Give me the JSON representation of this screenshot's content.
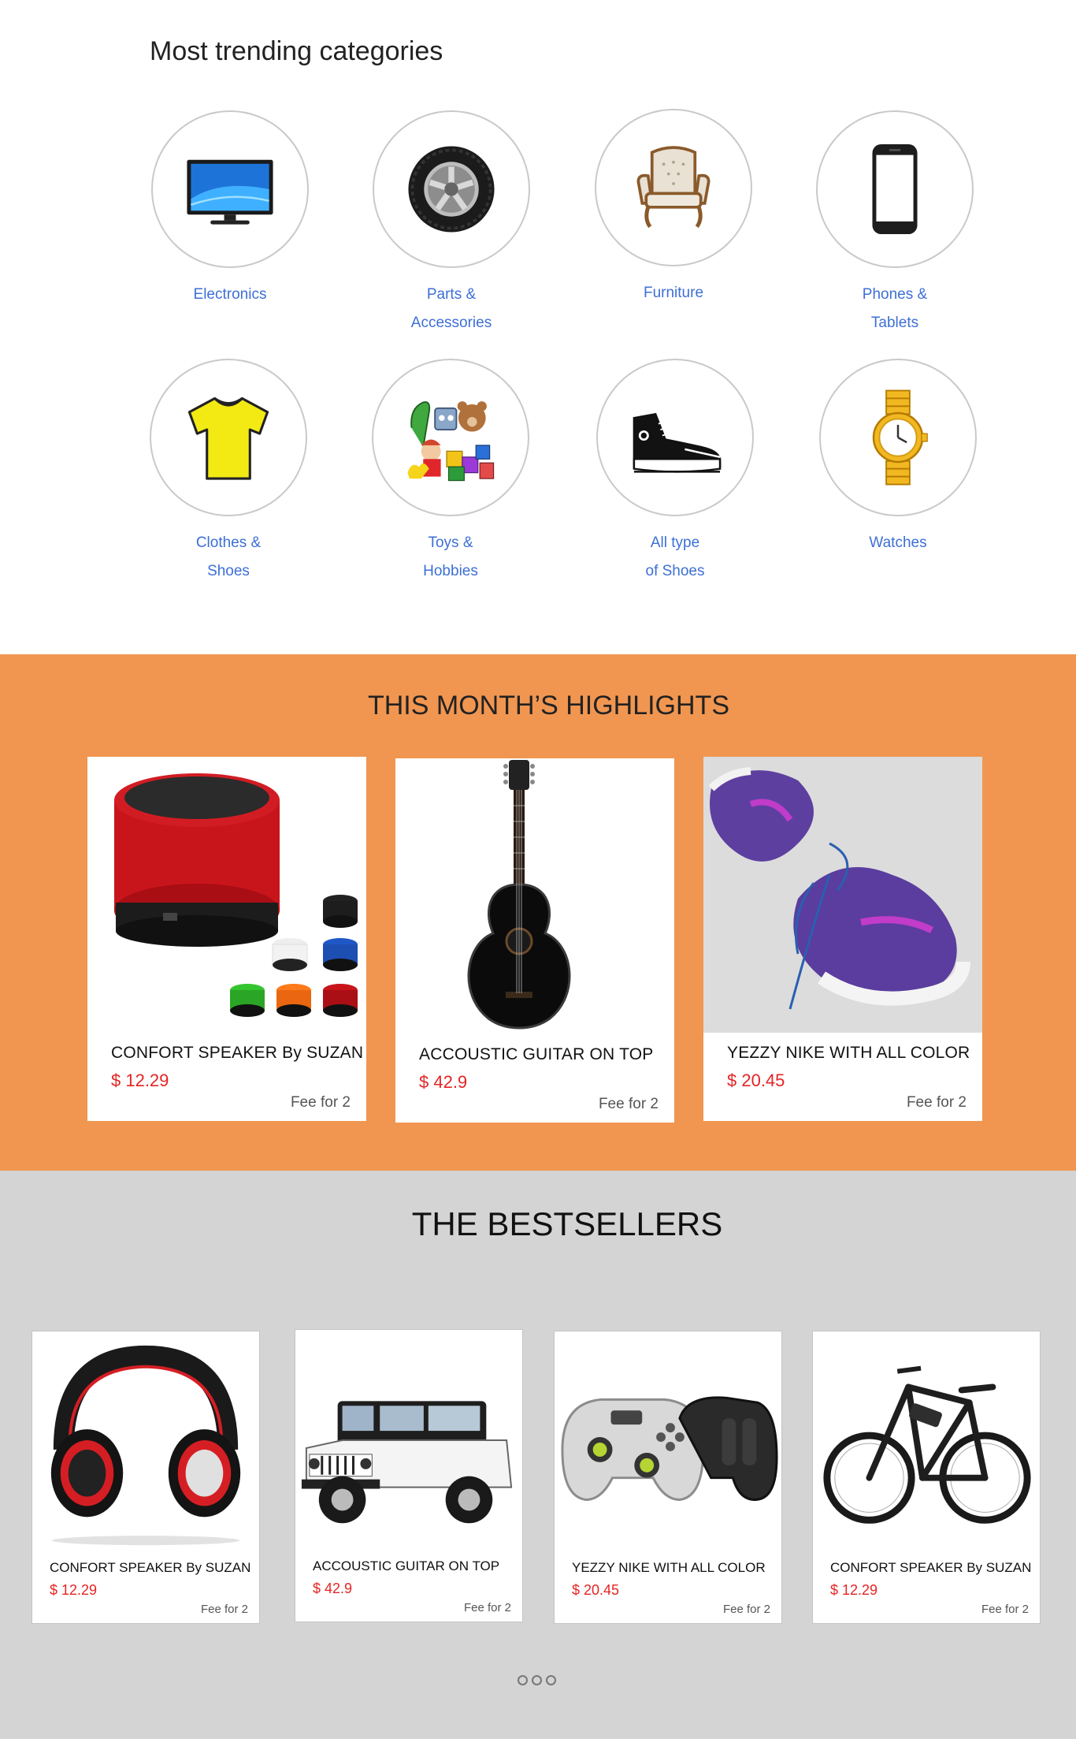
{
  "categories": {
    "title": "Most trending categories",
    "items": [
      {
        "label": "Electronics",
        "icon": "tv-icon"
      },
      {
        "label": "Parts &\nAccessories",
        "icon": "tire-icon"
      },
      {
        "label": "Furniture",
        "icon": "armchair-icon"
      },
      {
        "label": "Phones &\nTablets",
        "icon": "smartphone-icon"
      },
      {
        "label": "Clothes &\nShoes",
        "icon": "tshirt-icon"
      },
      {
        "label": "Toys &\nHobbies",
        "icon": "toys-icon"
      },
      {
        "label": "All type\nof Shoes",
        "icon": "sneaker-icon"
      },
      {
        "label": "Watches",
        "icon": "wristwatch-icon"
      }
    ]
  },
  "highlights": {
    "title": "THIS MONTH’S HIGHLIGHTS",
    "items": [
      {
        "name": "CONFORT SPEAKER By SUZAN",
        "price": "$ 12.29",
        "fee": "Fee for 2",
        "image": "speaker-image"
      },
      {
        "name": "ACCOUSTIC GUITAR ON TOP",
        "price": "$ 42.9",
        "fee": "Fee for 2",
        "image": "guitar-image"
      },
      {
        "name": "YEZZY NIKE WITH ALL COLOR",
        "price": "$ 20.45",
        "fee": "Fee for 2",
        "image": "sneakers-image"
      }
    ]
  },
  "bestsellers": {
    "title": "THE BESTSELLERS",
    "items": [
      {
        "name": "CONFORT SPEAKER By SUZAN",
        "price": "$ 12.29",
        "fee": "Fee for 2",
        "image": "headphones-image"
      },
      {
        "name": "ACCOUSTIC GUITAR ON TOP",
        "price": "$ 42.9",
        "fee": "Fee for 2",
        "image": "jeep-image"
      },
      {
        "name": "YEZZY NIKE WITH ALL COLOR",
        "price": "$ 20.45",
        "fee": "Fee for 2",
        "image": "gamepad-image"
      },
      {
        "name": "CONFORT SPEAKER By SUZAN",
        "price": "$ 12.29",
        "fee": "Fee for 2",
        "image": "ebike-image"
      }
    ],
    "carousel_pages": 3
  },
  "colors": {
    "highlight_bg": "#f19650",
    "bestseller_bg": "#d4d4d4",
    "category_label": "#3d6fd6",
    "price": "#e52424"
  }
}
